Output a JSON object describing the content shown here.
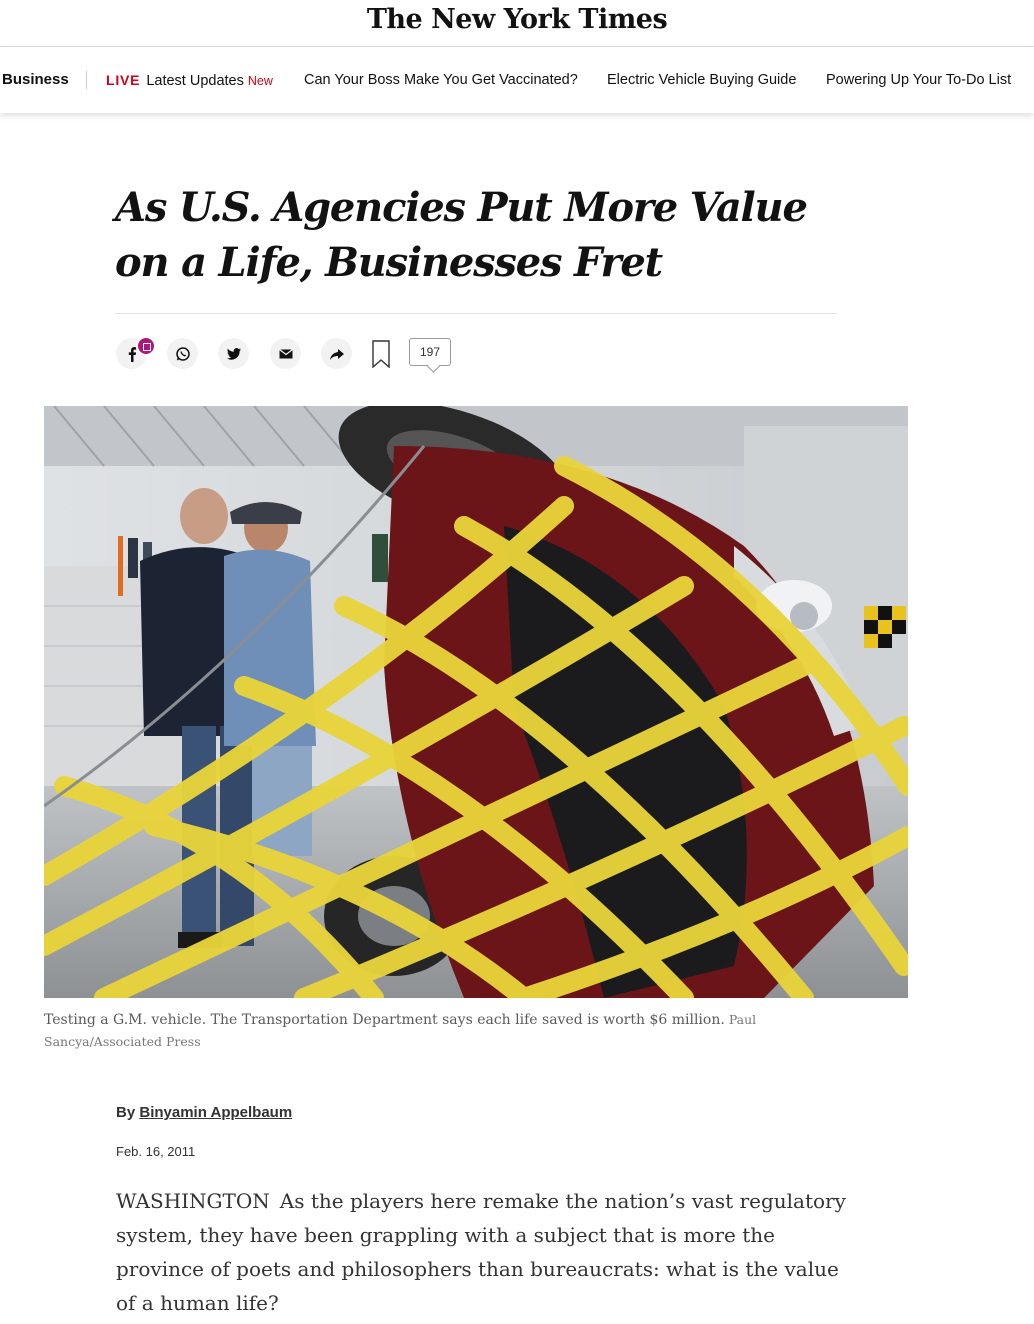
{
  "masthead": {
    "logo": "The New York Times"
  },
  "subnav": {
    "section": "Business",
    "live_label": "LIVE",
    "live_text": "Latest Updates",
    "new_label": "New",
    "links": [
      "Can Your Boss Make You Get Vaccinated?",
      "Electric Vehicle Buying Guide",
      "Powering Up Your To-Do List"
    ]
  },
  "article": {
    "headline": "As U.S. Agencies Put More Value on a Life, Businesses Fret",
    "comment_count": "197",
    "caption": "Testing a G.M. vehicle. The Transportation Department says each life saved is worth $6 million.",
    "credit": "Paul Sancya/Associated Press",
    "byline_prefix": "By",
    "author": "Binyamin Appelbaum",
    "date": "Feb. 16, 2011",
    "dateline": "WASHINGTON",
    "lede": "As the players here remake the nation’s vast regulatory system, they have been grappling with a subject that is more the province of poets and philosophers than bureaucrats: what is the value of a human life?"
  },
  "share_icons": [
    "facebook-icon",
    "whatsapp-icon",
    "twitter-icon",
    "email-icon",
    "share-arrow-icon",
    "bookmark-icon",
    "comment-icon"
  ],
  "colors": {
    "live_red": "#d0021b",
    "badge_magenta": "#b0157a",
    "strap_yellow": "#e8d43a"
  }
}
